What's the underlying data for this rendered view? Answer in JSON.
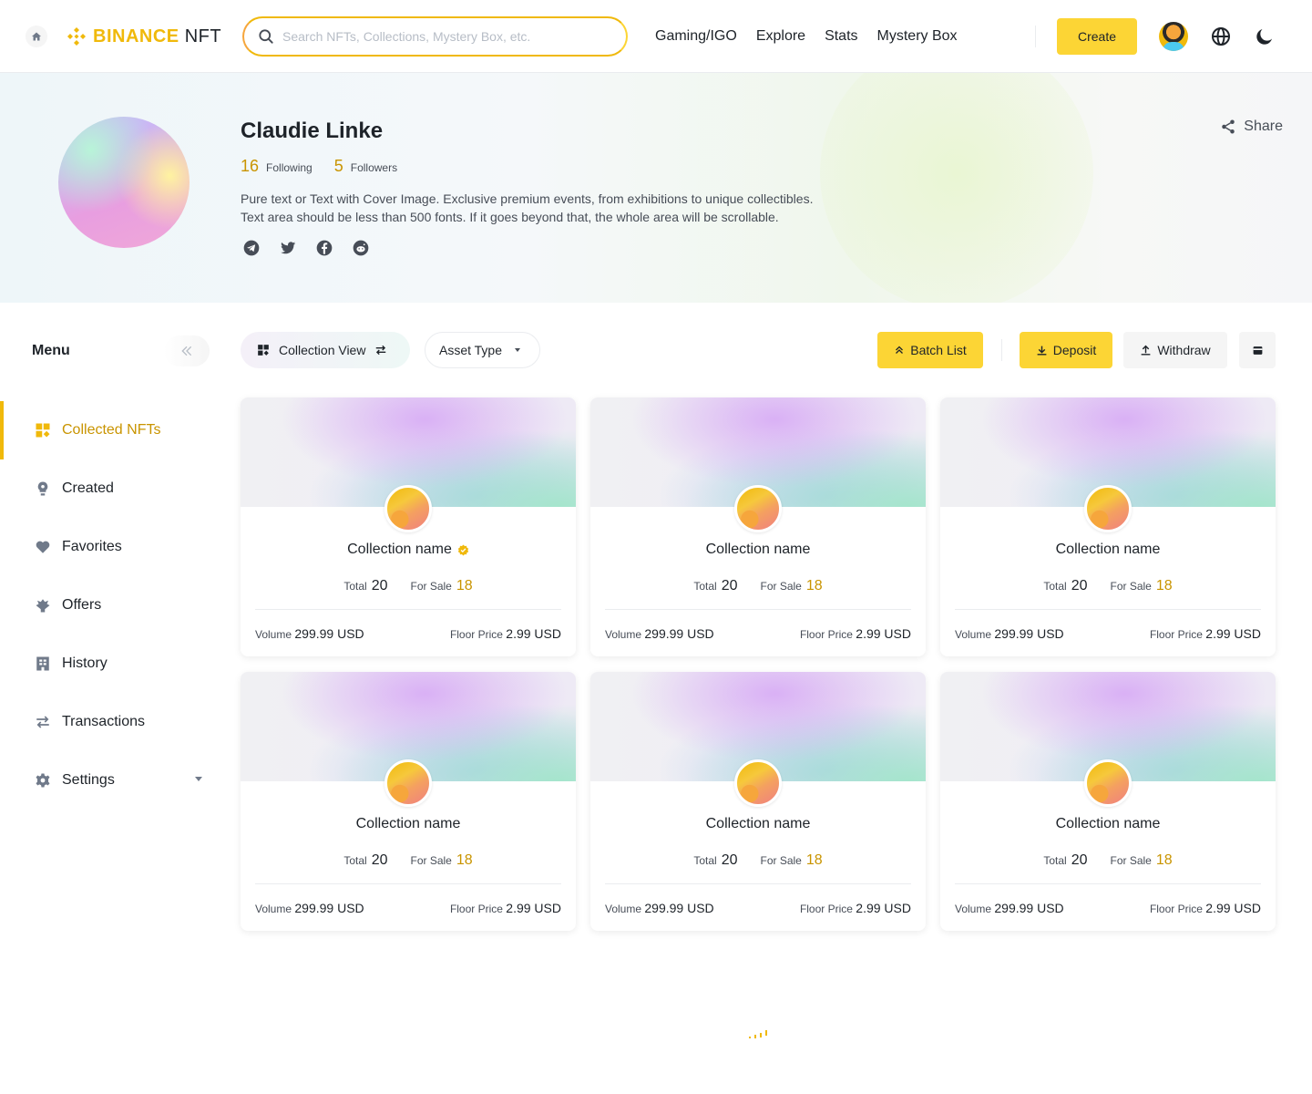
{
  "header": {
    "logo_text": "BINANCE",
    "logo_suffix": "NFT",
    "search_placeholder": "Search NFTs, Collections, Mystery Box, etc.",
    "nav": [
      "Gaming/IGO",
      "Explore",
      "Stats",
      "Mystery Box"
    ],
    "create_label": "Create"
  },
  "profile": {
    "name": "Claudie Linke",
    "following_count": "16",
    "following_label": "Following",
    "followers_count": "5",
    "followers_label": "Followers",
    "bio_line1": "Pure text or Text with Cover Image. Exclusive premium events, from exhibitions to unique collectibles.",
    "bio_line2": "Text area should be less than 500 fonts. If it goes beyond that, the whole area will be scrollable.",
    "socials": [
      "telegram-icon",
      "twitter-icon",
      "facebook-icon",
      "reddit-icon"
    ],
    "share_label": "Share"
  },
  "sidebar": {
    "title": "Menu",
    "items": [
      {
        "label": "Collected NFTs",
        "icon": "grid-icon",
        "active": true
      },
      {
        "label": "Created",
        "icon": "bulb-icon"
      },
      {
        "label": "Favorites",
        "icon": "heart-icon"
      },
      {
        "label": "Offers",
        "icon": "offer-icon"
      },
      {
        "label": "History",
        "icon": "history-icon"
      },
      {
        "label": "Transactions",
        "icon": "swap-icon"
      },
      {
        "label": "Settings",
        "icon": "gear-icon"
      }
    ]
  },
  "toolbar": {
    "view_label": "Collection View",
    "asset_label": "Asset Type",
    "batch_label": "Batch List",
    "deposit_label": "Deposit",
    "withdraw_label": "Withdraw"
  },
  "card_labels": {
    "total": "Total",
    "for_sale": "For Sale",
    "volume": "Volume",
    "floor_price": "Floor Price"
  },
  "cards": [
    {
      "name": "Collection name",
      "verified": true,
      "total": "20",
      "for_sale": "18",
      "volume": "299.99 USD",
      "floor": "2.99 USD"
    },
    {
      "name": "Collection name",
      "verified": false,
      "total": "20",
      "for_sale": "18",
      "volume": "299.99 USD",
      "floor": "2.99 USD"
    },
    {
      "name": "Collection name",
      "verified": false,
      "total": "20",
      "for_sale": "18",
      "volume": "299.99 USD",
      "floor": "2.99 USD"
    },
    {
      "name": "Collection name",
      "verified": false,
      "total": "20",
      "for_sale": "18",
      "volume": "299.99 USD",
      "floor": "2.99 USD"
    },
    {
      "name": "Collection name",
      "verified": false,
      "total": "20",
      "for_sale": "18",
      "volume": "299.99 USD",
      "floor": "2.99 USD"
    },
    {
      "name": "Collection name",
      "verified": false,
      "total": "20",
      "for_sale": "18",
      "volume": "299.99 USD",
      "floor": "2.99 USD"
    }
  ],
  "colors": {
    "brand": "#f0b90b",
    "button": "#fcd535",
    "accent_text": "#c99400"
  }
}
